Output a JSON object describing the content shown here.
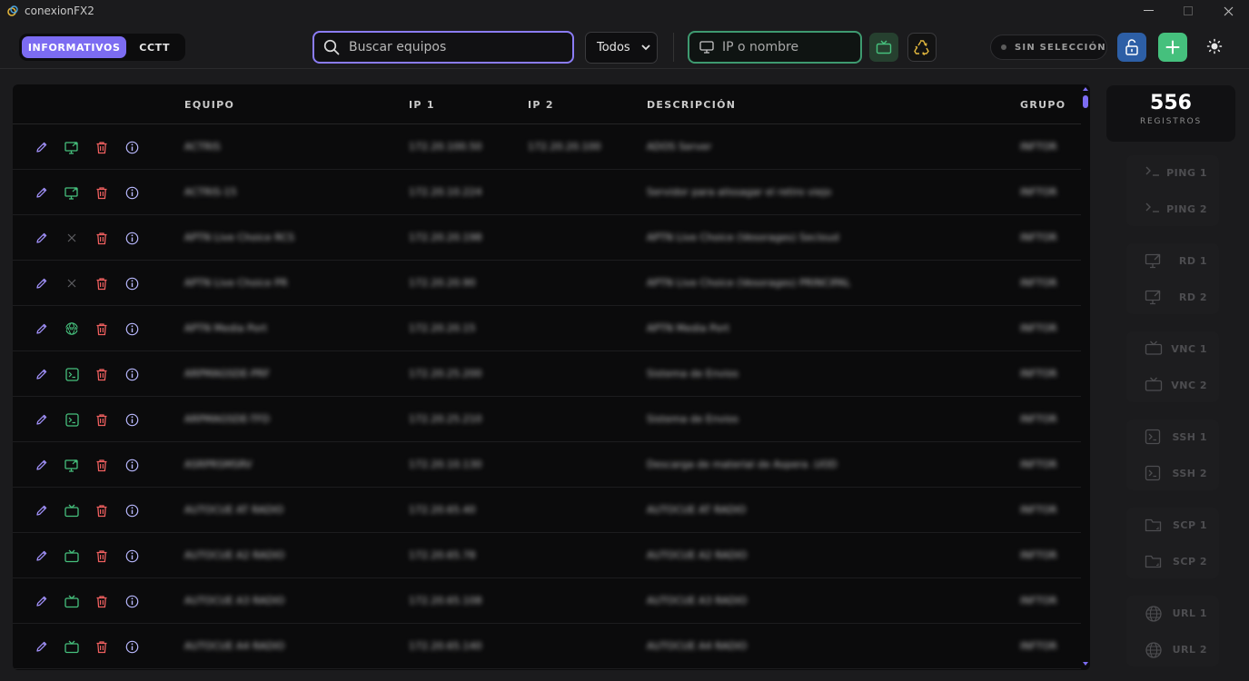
{
  "window": {
    "title": "conexionFX2"
  },
  "toolbar": {
    "tabs": [
      {
        "label": "INFORMATIVOS",
        "active": true
      },
      {
        "label": "CCTT",
        "active": false
      }
    ],
    "search_placeholder": "Buscar equipos",
    "filter_selected": "Todos",
    "ip_placeholder": "IP o nombre",
    "selection_status": "SIN SELECCIÓN"
  },
  "table": {
    "columns": [
      "EQUIPO",
      "IP 1",
      "IP 2",
      "DESCRIPCIÓN",
      "GRUPO"
    ],
    "rows": [
      {
        "connection": "remote-desktop",
        "equipo": "ACTRIS",
        "ip1": "172.20.100.50",
        "ip2": "172.20.20.100",
        "descripcion": "ADOS Server",
        "grupo": "INFTOR"
      },
      {
        "connection": "remote-desktop",
        "equipo": "ACTRIS-15",
        "ip1": "172.20.10.224",
        "ip2": "",
        "descripcion": "Servidor para alissagar el retiro viejo",
        "grupo": "INFTOR"
      },
      {
        "connection": "none",
        "equipo": "APTN Live Choice RCS",
        "ip1": "172.20.20.198",
        "ip2": "",
        "descripcion": "APTN Live Choice (Vesorages) Secloud",
        "grupo": "INFTOR"
      },
      {
        "connection": "none",
        "equipo": "APTN Live Choice PR",
        "ip1": "172.20.20.90",
        "ip2": "",
        "descripcion": "APTN Live Choice (Vesorages) PRINCIPAL",
        "grupo": "INFTOR"
      },
      {
        "connection": "web",
        "equipo": "APTN Media Port",
        "ip1": "172.20.20.15",
        "ip2": "",
        "descripcion": "APTN Media Port",
        "grupo": "INFTOR"
      },
      {
        "connection": "ssh",
        "equipo": "ARPMAGSDE-PRF",
        "ip1": "172.20.25.200",
        "ip2": "",
        "descripcion": "Sistema de Envios",
        "grupo": "INFTOR"
      },
      {
        "connection": "ssh",
        "equipo": "ARPMAGSDE-TFD",
        "ip1": "172.20.25.210",
        "ip2": "",
        "descripcion": "Sistema de Envios",
        "grupo": "INFTOR"
      },
      {
        "connection": "remote-desktop",
        "equipo": "ASRPRSMSRV",
        "ip1": "172.20.10.130",
        "ip2": "",
        "descripcion": "Descarga de material de Aspera .UOD",
        "grupo": "INFTOR"
      },
      {
        "connection": "vnc",
        "equipo": "AUTOCUE AT RADIO",
        "ip1": "172.20.65.40",
        "ip2": "",
        "descripcion": "AUTOCUE AT RADIO",
        "grupo": "INFTOR"
      },
      {
        "connection": "vnc",
        "equipo": "AUTOCUE A2 RADIO",
        "ip1": "172.20.65.78",
        "ip2": "",
        "descripcion": "AUTOCUE A2 RADIO",
        "grupo": "INFTOR"
      },
      {
        "connection": "vnc",
        "equipo": "AUTOCUE A3 RADIO",
        "ip1": "172.20.65.108",
        "ip2": "",
        "descripcion": "AUTOCUE A3 RADIO",
        "grupo": "INFTOR"
      },
      {
        "connection": "vnc",
        "equipo": "AUTOCUE A4 RADIO",
        "ip1": "172.20.65.140",
        "ip2": "",
        "descripcion": "AUTOCUE A4 RADIO",
        "grupo": "INFTOR"
      }
    ]
  },
  "stats": {
    "count": "556",
    "label": "REGISTROS"
  },
  "quick_actions": [
    {
      "icon": "terminal-prompt-icon",
      "label": "PING 1"
    },
    {
      "icon": "terminal-prompt-icon",
      "label": "PING 2"
    },
    {
      "icon": "remote-desktop-icon",
      "label": "RD 1"
    },
    {
      "icon": "remote-desktop-icon",
      "label": "RD 2"
    },
    {
      "icon": "tv-icon",
      "label": "VNC 1"
    },
    {
      "icon": "tv-icon",
      "label": "VNC 2"
    },
    {
      "icon": "terminal-icon",
      "label": "SSH 1"
    },
    {
      "icon": "terminal-icon",
      "label": "SSH 2"
    },
    {
      "icon": "folder-icon",
      "label": "SCP 1"
    },
    {
      "icon": "folder-icon",
      "label": "SCP 2"
    },
    {
      "icon": "globe-icon",
      "label": "URL 1"
    },
    {
      "icon": "globe-icon",
      "label": "URL 2"
    }
  ],
  "colors": {
    "accent": "#7c6cf2",
    "green": "#3ecf8e",
    "danger": "#ef5f5f",
    "background": "#1b1b1d"
  }
}
